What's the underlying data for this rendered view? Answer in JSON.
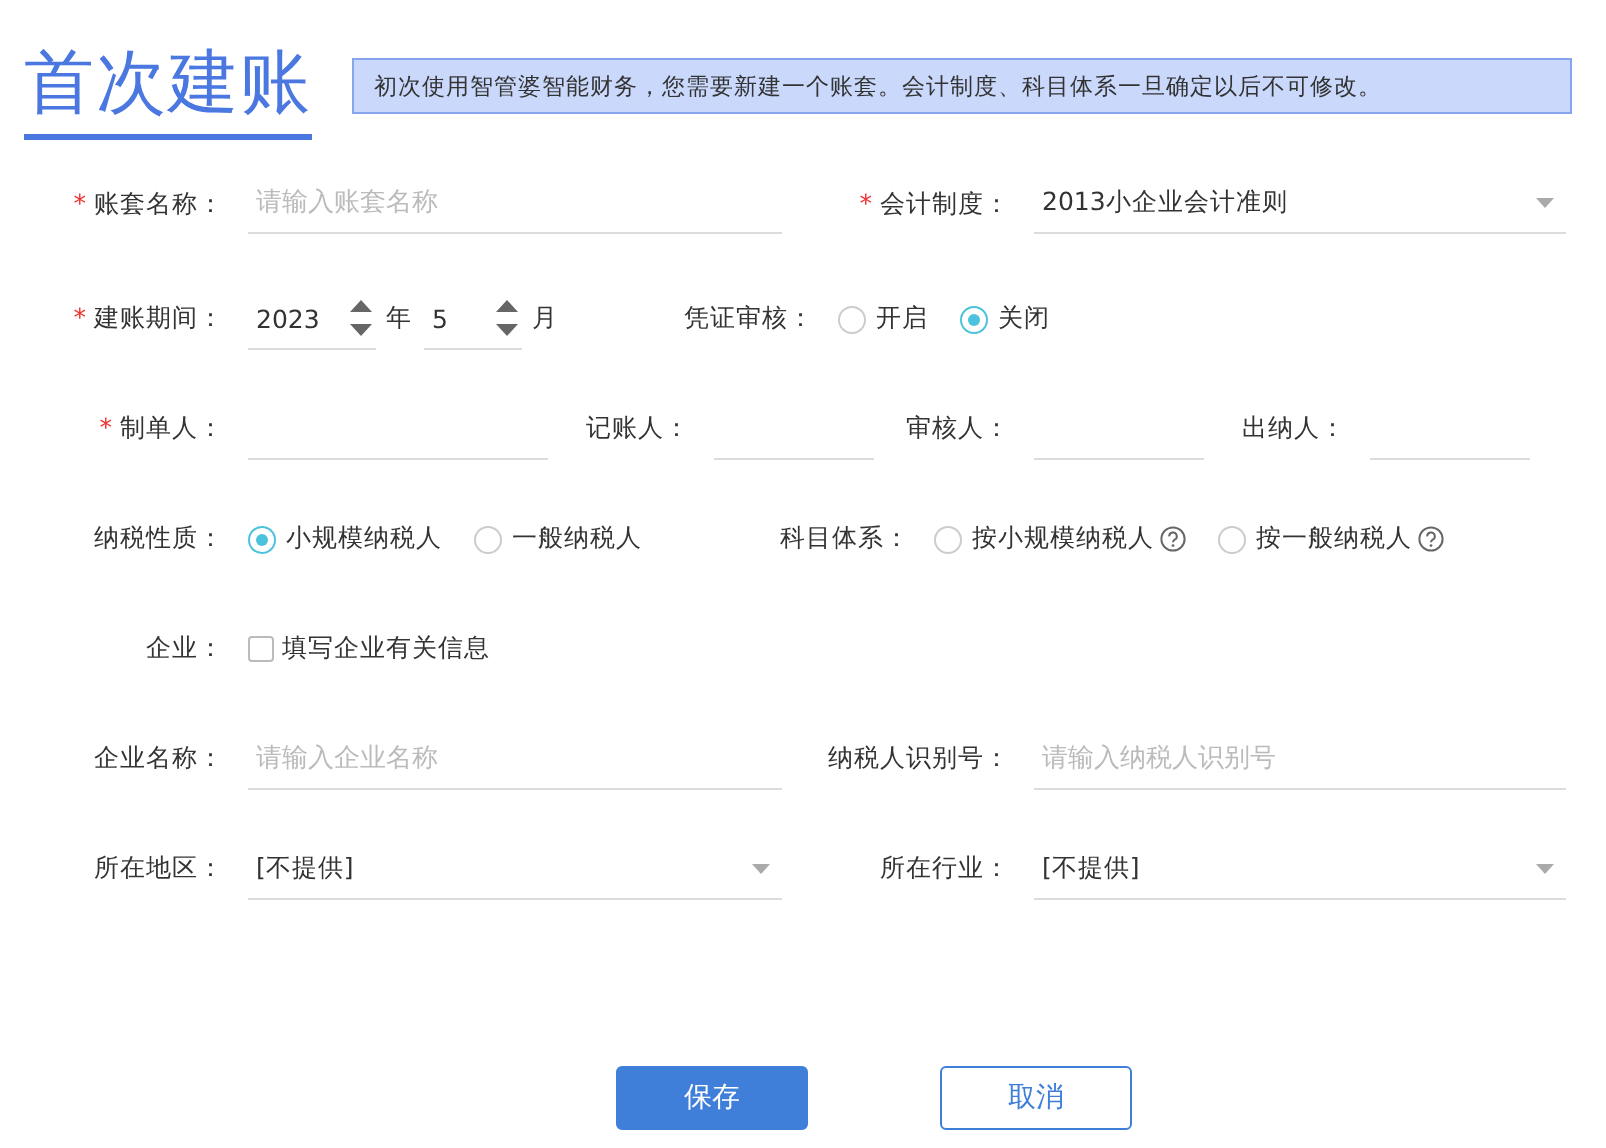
{
  "title": "首次建账",
  "notice": "初次使用智管婆智能财务，您需要新建一个账套。会计制度、科目体系一旦确定以后不可修改。",
  "account_name": {
    "required_mark": "*",
    "label": "账套名称：",
    "placeholder": "请输入账套名称"
  },
  "accounting_standard": {
    "required_mark": "*",
    "label": "会计制度：",
    "value": "2013小企业会计准则"
  },
  "period": {
    "required_mark": "*",
    "label": "建账期间：",
    "year": "2023",
    "year_unit": "年",
    "month": "5",
    "month_unit": "月"
  },
  "voucher_review": {
    "label": "凭证审核：",
    "options": [
      {
        "label": "开启",
        "selected": false
      },
      {
        "label": "关闭",
        "selected": true
      }
    ]
  },
  "staff": [
    {
      "required_mark": "*",
      "label": "制单人："
    },
    {
      "label": "记账人："
    },
    {
      "label": "审核人："
    },
    {
      "label": "出纳人："
    }
  ],
  "tax_type": {
    "label": "纳税性质：",
    "options": [
      {
        "label": "小规模纳税人",
        "selected": true
      },
      {
        "label": "一般纳税人",
        "selected": false
      }
    ]
  },
  "chart_of_accounts": {
    "label": "科目体系：",
    "options": [
      {
        "label": "按小规模纳税人",
        "selected": false,
        "help": true
      },
      {
        "label": "按一般纳税人",
        "selected": false,
        "help": true
      }
    ]
  },
  "enterprise": {
    "label": "企业：",
    "checkbox": {
      "label": "填写企业有关信息",
      "checked": false
    }
  },
  "company_name": {
    "label": "企业名称：",
    "placeholder": "请输入企业名称"
  },
  "taxpayer_id": {
    "label": "纳税人识别号：",
    "placeholder": "请输入纳税人识别号"
  },
  "region": {
    "label": "所在地区：",
    "value": "[不提供]"
  },
  "industry": {
    "label": "所在行业：",
    "value": "[不提供]"
  },
  "buttons": [
    {
      "label": "保存",
      "kind": "primary"
    },
    {
      "label": "取消",
      "kind": "secondary"
    }
  ]
}
